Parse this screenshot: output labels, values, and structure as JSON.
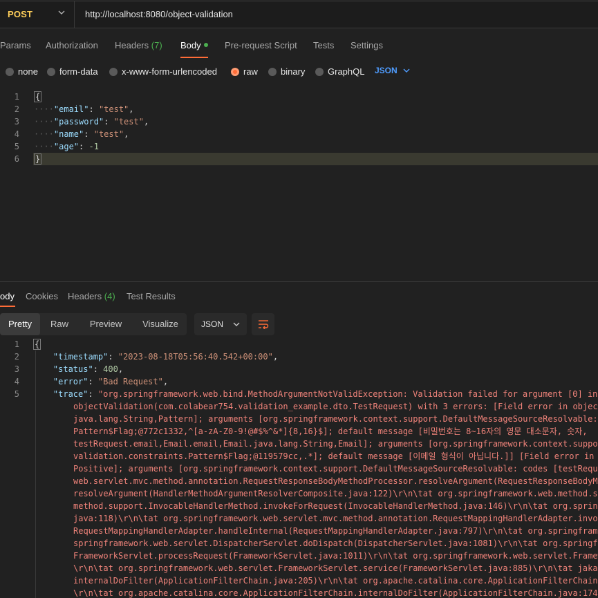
{
  "request": {
    "method": "POST",
    "url": "http://localhost:8080/object-validation"
  },
  "tabs": [
    {
      "label": "Params"
    },
    {
      "label": "Authorization"
    },
    {
      "label": "Headers",
      "count": "(7)"
    },
    {
      "label": "Body"
    },
    {
      "label": "Pre-request Script"
    },
    {
      "label": "Tests"
    },
    {
      "label": "Settings"
    }
  ],
  "body_types": [
    "none",
    "form-data",
    "x-www-form-urlencoded",
    "raw",
    "binary",
    "GraphQL"
  ],
  "body_format": "JSON",
  "request_body": {
    "line_numbers": [
      "1",
      "2",
      "3",
      "4",
      "5",
      "6"
    ],
    "open": "{",
    "close": "}",
    "fields": [
      {
        "key": "\"email\"",
        "value": "\"test\"",
        "sep": ","
      },
      {
        "key": "\"password\"",
        "value": "\"test\"",
        "sep": ","
      },
      {
        "key": "\"name\"",
        "value": "\"test\"",
        "sep": ","
      },
      {
        "key": "\"age\"",
        "value": "-1",
        "sep": ""
      }
    ]
  },
  "response_tabs": [
    {
      "label": "ody"
    },
    {
      "label": "Cookies"
    },
    {
      "label": "Headers",
      "count": "(4)"
    },
    {
      "label": "Test Results"
    }
  ],
  "view_modes": [
    "Pretty",
    "Raw",
    "Preview",
    "Visualize"
  ],
  "response_format": "JSON",
  "response": {
    "line_numbers": [
      "1",
      "2",
      "3",
      "4",
      "5"
    ],
    "open": "{",
    "timestamp_key": "\"timestamp\"",
    "timestamp_val": "\"2023-08-18T05:56:40.542+00:00\"",
    "status_key": "\"status\"",
    "status_val": "400",
    "error_key": "\"error\"",
    "error_val": "\"Bad Request\"",
    "trace_key": "\"trace\"",
    "trace_first": "\"org.springframework.web.bind.MethodArgumentNotValidException: Validation failed for argument [0] in",
    "trace_lines": [
      "objectValidation(com.colabear754.validation_example.dto.TestRequest) with 3 errors: [Field error in object",
      "java.lang.String,Pattern]; arguments [org.springframework.context.support.DefaultMessageSourceResolvable:",
      "Pattern$Flag;@772c1332,^[a-zA-Z0-9!@#$%^&*]{8,16}$]; default message [비밀번호는 8~16자의 영문 대소문자, 숫자,",
      "testRequest.email,Email.email,Email.java.lang.String,Email]; arguments [org.springframework.context.suppor",
      "validation.constraints.Pattern$Flag;@119579cc,.*]; default message [이메일 형식이 아닙니다.]] [Field error in",
      "Positive]; arguments [org.springframework.context.support.DefaultMessageSourceResolvable: codes [testReque",
      "web.servlet.mvc.method.annotation.RequestResponseBodyMethodProcessor.resolveArgument(RequestResponseBodyMe",
      "resolveArgument(HandlerMethodArgumentResolverComposite.java:122)\\r\\n\\tat org.springframework.web.method.su",
      "method.support.InvocableHandlerMethod.invokeForRequest(InvocableHandlerMethod.java:146)\\r\\n\\tat org.spring",
      "java:118)\\r\\n\\tat org.springframework.web.servlet.mvc.method.annotation.RequestMappingHandlerAdapter.invok",
      "RequestMappingHandlerAdapter.handleInternal(RequestMappingHandlerAdapter.java:797)\\r\\n\\tat org.springframe",
      "springframework.web.servlet.DispatcherServlet.doDispatch(DispatcherServlet.java:1081)\\r\\n\\tat org.springfr",
      "FrameworkServlet.processRequest(FrameworkServlet.java:1011)\\r\\n\\tat org.springframework.web.servlet.Framew",
      "\\r\\n\\tat org.springframework.web.servlet.FrameworkServlet.service(FrameworkServlet.java:885)\\r\\n\\tat jakar",
      "internalDoFilter(ApplicationFilterChain.java:205)\\r\\n\\tat org.apache.catalina.core.ApplicationFilterChain.",
      "\\r\\n\\tat org.apache.catalina.core.ApplicationFilterChain.internalDoFilter(ApplicationFilterChain.java:174"
    ]
  },
  "icons": {
    "method_dropdown": "chevron-down-icon",
    "format_dropdown": "chevron-down-icon",
    "wrap": "wrap-lines-icon"
  },
  "colors": {
    "accent": "#ff6c37",
    "method": "#ffcf5a",
    "link_blue": "#4f9cff",
    "count_green": "#4caf50"
  }
}
